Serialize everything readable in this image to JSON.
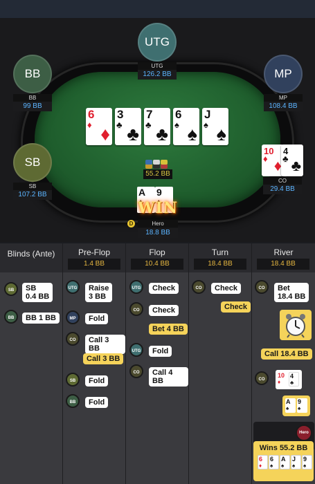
{
  "table": {
    "seats": {
      "utg": {
        "label": "UTG",
        "name": "UTG",
        "stack": "126.2 BB",
        "color": "#3f6f70"
      },
      "bb": {
        "label": "BB",
        "name": "BB",
        "stack": "99 BB",
        "color": "#3d5e45"
      },
      "mp": {
        "label": "MP",
        "name": "MP",
        "stack": "108.4 BB",
        "color": "#31415d"
      },
      "sb": {
        "label": "SB",
        "name": "SB",
        "stack": "107.2 BB",
        "color": "#5e6a33"
      },
      "co": {
        "label": "CO",
        "name": "CO",
        "stack": "29.4 BB"
      }
    },
    "board": [
      {
        "rank": "6",
        "suit": "♦",
        "color": "red"
      },
      {
        "rank": "3",
        "suit": "♣",
        "color": "blk"
      },
      {
        "rank": "7",
        "suit": "♣",
        "color": "blk"
      },
      {
        "rank": "6",
        "suit": "♠",
        "color": "blk"
      },
      {
        "rank": "J",
        "suit": "♠",
        "color": "blk"
      }
    ],
    "pot": "55.2 BB",
    "hero": {
      "name": "Hero",
      "stack": "18.8 BB",
      "cards": [
        {
          "rank": "A",
          "suit": "♠"
        },
        {
          "rank": "9",
          "suit": "♠"
        }
      ],
      "win_text": "WIN",
      "dealer": "D"
    },
    "co_cards": [
      {
        "rank": "10",
        "suit": "♦",
        "color": "red"
      },
      {
        "rank": "4",
        "suit": "♣",
        "color": "blk"
      }
    ]
  },
  "streets": [
    {
      "title": "Blinds (Ante)",
      "pot": ""
    },
    {
      "title": "Pre-Flop",
      "pot": "1.4 BB"
    },
    {
      "title": "Flop",
      "pot": "10.4 BB"
    },
    {
      "title": "Turn",
      "pot": "18.4 BB"
    },
    {
      "title": "River",
      "pot": "18.4 BB"
    }
  ],
  "actions": {
    "blinds": [
      {
        "pos": "SB",
        "text": "SB\n0.4 BB"
      },
      {
        "pos": "BB",
        "text": "BB 1 BB"
      }
    ],
    "preflop": [
      {
        "pos": "UTG",
        "text": "Raise\n3 BB"
      },
      {
        "pos": "MP",
        "text": "Fold"
      },
      {
        "pos": "CO",
        "text": "Call 3 BB"
      },
      {
        "pos": "",
        "text": "Call 3 BB"
      },
      {
        "pos": "SB",
        "text": "Fold"
      },
      {
        "pos": "BB",
        "text": "Fold"
      }
    ],
    "flop": [
      {
        "pos": "UTG",
        "text": "Check"
      },
      {
        "pos": "CO",
        "text": "Check"
      },
      {
        "pos": "",
        "text": "Bet 4 BB"
      },
      {
        "pos": "UTG",
        "text": "Fold"
      },
      {
        "pos": "CO",
        "text": "Call 4 BB"
      }
    ],
    "turn": [
      {
        "pos": "CO",
        "text": "Check"
      },
      {
        "pos": "",
        "text": "Check"
      }
    ],
    "river": [
      {
        "pos": "CO",
        "text": "Bet\n18.4 BB"
      },
      {
        "pos": "",
        "text": "Call 18.4 BB"
      },
      {
        "pos": "CO",
        "text": ""
      },
      {
        "pos": "Hero",
        "text": "Wins 55.2 BB"
      }
    ]
  },
  "icons": {
    "clock": "alarm-clock-icon"
  }
}
